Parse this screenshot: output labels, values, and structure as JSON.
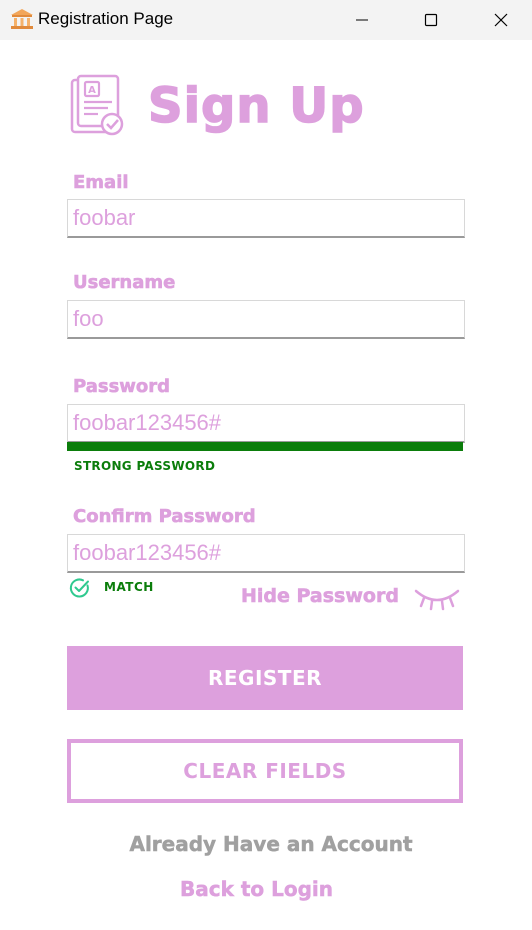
{
  "window": {
    "title": "Registration Page",
    "icon": "bank-building-icon"
  },
  "theme": {
    "accent": "#dda0dd",
    "success": "#0b7d0b",
    "muted": "#a0a0a0"
  },
  "header": {
    "title": "Sign Up",
    "icon": "registration-form-icon"
  },
  "form": {
    "email": {
      "label": "Email",
      "value": "foobar"
    },
    "username": {
      "label": "Username",
      "value": "foo"
    },
    "password": {
      "label": "Password",
      "value": "foobar123456#",
      "strength_text": "STRONG PASSWORD",
      "strength_fraction": 1.0
    },
    "confirm_password": {
      "label": "Confirm Password",
      "value": "foobar123456#",
      "match_text": "MATCH"
    },
    "toggle_visibility_label": "Hide Password"
  },
  "actions": {
    "register_label": "REGISTER",
    "clear_label": "CLEAR FIELDS"
  },
  "footer": {
    "prompt": "Already Have an Account",
    "link": "Back to Login"
  }
}
